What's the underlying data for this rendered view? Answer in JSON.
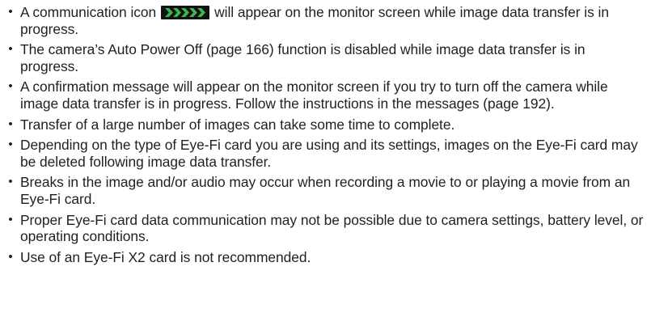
{
  "items": [
    {
      "before": "A communication icon",
      "icon": "eye-fi-communication-icon",
      "after": "will appear on the monitor screen while image data transfer is in progress."
    },
    {
      "text": "The camera’s Auto Power Off (page 166) function is disabled while image data transfer is in progress."
    },
    {
      "text": "A confirmation message will appear on the monitor screen if you try to turn off the camera while image data transfer is in progress. Follow the instructions in the messages (page 192)."
    },
    {
      "text": "Transfer of a large number of images can take some time to complete."
    },
    {
      "text": "Depending on the type of Eye-Fi card you are using and its settings, images on the Eye-Fi card may be deleted following image data transfer."
    },
    {
      "text": "Breaks in the image and/or audio may occur when recording a movie to or playing a movie from an Eye-Fi card."
    },
    {
      "text": "Proper Eye-Fi card data communication may not be possible due to camera settings, battery level, or operating conditions."
    },
    {
      "text": "Use of an Eye-Fi X2 card is not recommended."
    }
  ],
  "bullet_glyph": "•",
  "colors": {
    "text": "#231f20",
    "icon_background": "#111111",
    "icon_arrows": "#3cb54a"
  }
}
